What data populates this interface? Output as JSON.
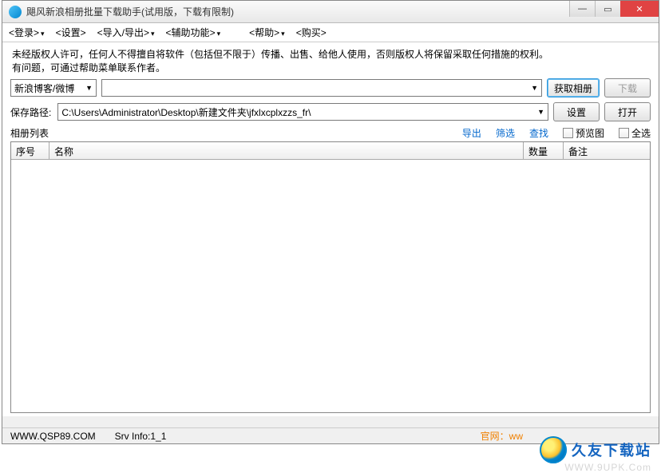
{
  "titlebar": {
    "title": "飓风新浪相册批量下载助手(试用版，下载有限制)"
  },
  "menu": {
    "login": "登录",
    "settings": "设置",
    "import_export": "导入/导出",
    "aux": "辅助功能",
    "help": "帮助",
    "buy": "购买"
  },
  "warning": {
    "line1": "未经版权人许可，任何人不得擅自将软件（包括但不限于）传播、出售、给他人使用，否则版权人将保留采取任何措施的权利。",
    "line2": "有问题，可通过帮助菜单联系作者。"
  },
  "source": {
    "selected": "新浪博客/微博"
  },
  "actions": {
    "get_album": "获取相册",
    "download": "下载",
    "settings": "设置",
    "open": "打开"
  },
  "save_path": {
    "label": "保存路径:",
    "value": "C:\\Users\\Administrator\\Desktop\\新建文件夹\\jfxlxcplxzzs_fr\\"
  },
  "list": {
    "title": "相册列表",
    "export": "导出",
    "filter": "筛选",
    "search": "查找",
    "preview": "预览图",
    "select_all": "全选"
  },
  "table": {
    "headers": {
      "seq": "序号",
      "name": "名称",
      "count": "数量",
      "note": "备注"
    },
    "rows": []
  },
  "statusbar": {
    "site": "WWW.QSP89.COM",
    "srv": "Srv Info:1_1",
    "official": "官网：ww"
  },
  "watermark": {
    "text": "久友下载站",
    "sub": "WWW.9UPK.Com"
  }
}
